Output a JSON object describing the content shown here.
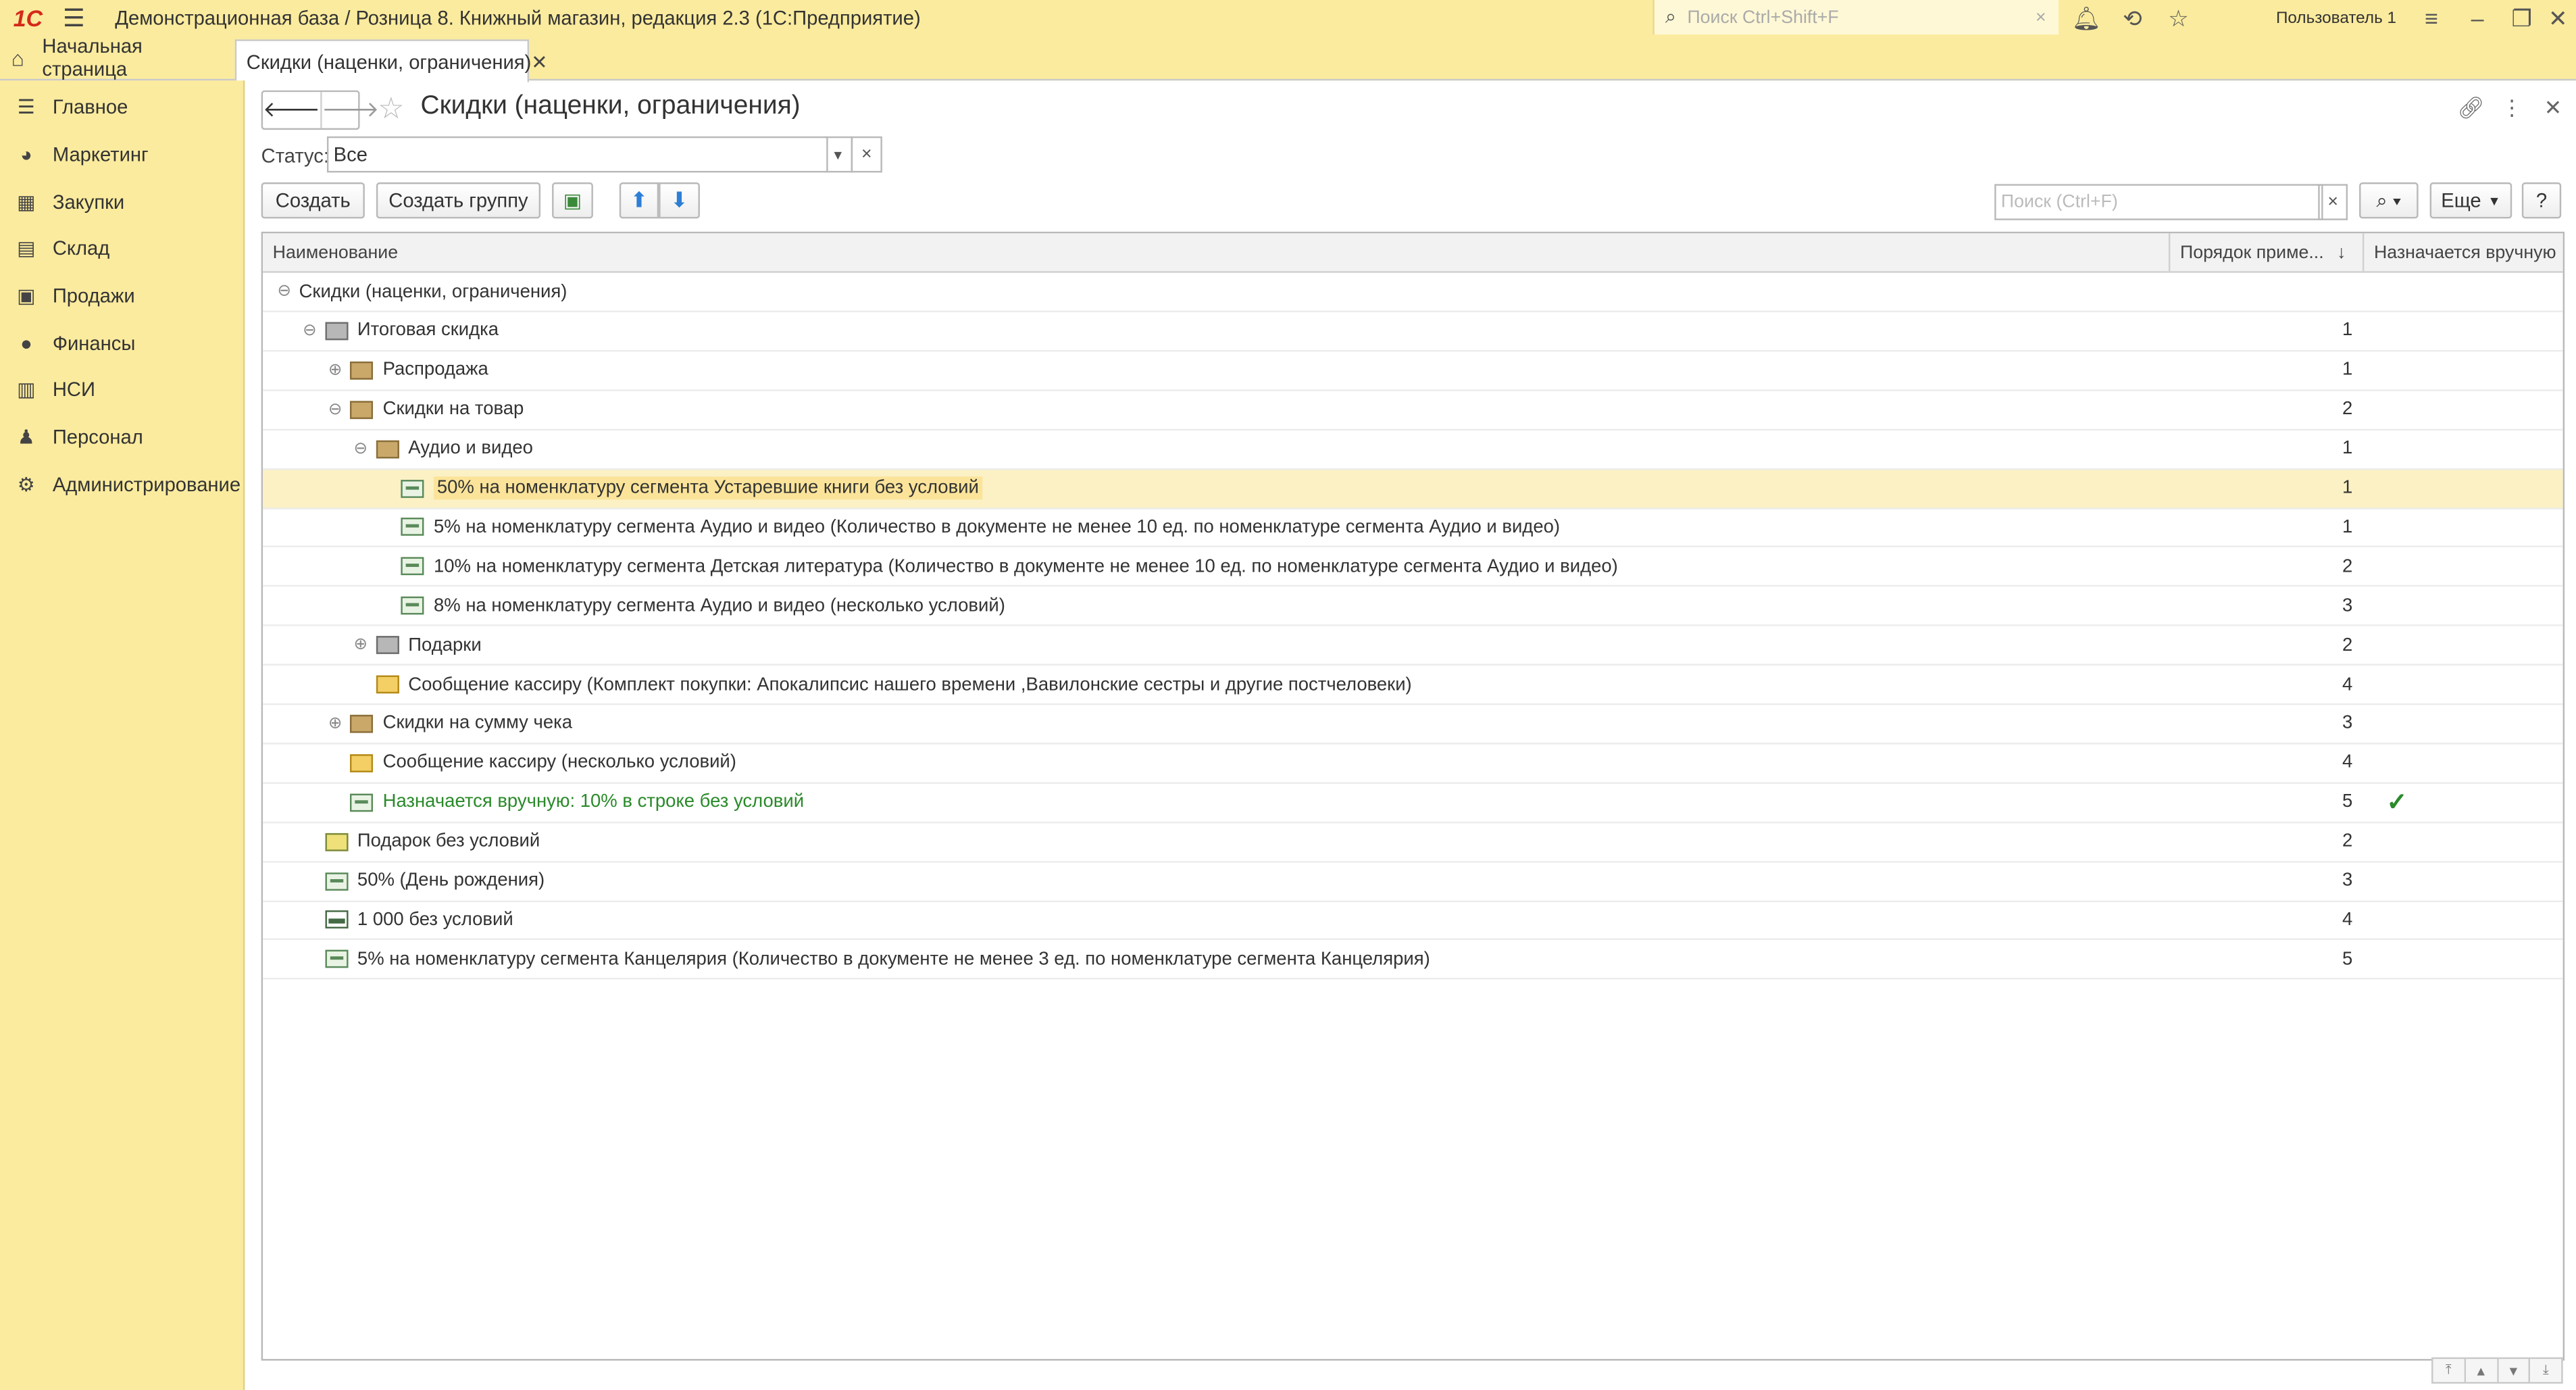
{
  "app": {
    "logo_text": "1С",
    "title": "Демонстрационная база / Розница 8. Книжный магазин, редакция 2.3  (1С:Предприятие)",
    "search_placeholder": "Поиск Ctrl+Shift+F",
    "user": "Пользователь 1"
  },
  "tabs": {
    "home_label": "Начальная страница",
    "active_label": "Скидки (наценки, ограничения)"
  },
  "sidebar": {
    "items": [
      {
        "label": "Главное",
        "icon": "menu-lines-icon"
      },
      {
        "label": "Маркетинг",
        "icon": "pie-chart-icon"
      },
      {
        "label": "Закупки",
        "icon": "grid-icon"
      },
      {
        "label": "Склад",
        "icon": "warehouse-icon"
      },
      {
        "label": "Продажи",
        "icon": "cart-icon"
      },
      {
        "label": "Финансы",
        "icon": "ruble-icon"
      },
      {
        "label": "НСИ",
        "icon": "book-icon"
      },
      {
        "label": "Персонал",
        "icon": "person-icon"
      },
      {
        "label": "Администрирование",
        "icon": "gear-icon"
      }
    ]
  },
  "form": {
    "title": "Скидки (наценки, ограничения)",
    "status_label": "Статус:",
    "status_value": "Все",
    "create_label": "Создать",
    "create_group_label": "Создать группу",
    "search_placeholder": "Поиск (Ctrl+F)",
    "more_label": "Еще",
    "help_label": "?"
  },
  "table": {
    "columns": [
      "Наименование",
      "Порядок приме...",
      "Назначается вручную"
    ],
    "rows": [
      {
        "level": 0,
        "toggle": "⊖",
        "icon": "none",
        "name": "Скидки (наценки, ограничения)",
        "order": ""
      },
      {
        "level": 1,
        "toggle": "⊖",
        "icon": "group",
        "name": "Итоговая скидка",
        "order": "1"
      },
      {
        "level": 2,
        "toggle": "⊕",
        "icon": "folder",
        "name": "Распродажа",
        "order": "1"
      },
      {
        "level": 2,
        "toggle": "⊖",
        "icon": "folder",
        "name": "Скидки на товар",
        "order": "2"
      },
      {
        "level": 3,
        "toggle": "⊖",
        "icon": "folder",
        "name": "Аудио и видео",
        "order": "1"
      },
      {
        "level": 4,
        "toggle": "",
        "icon": "item",
        "name": "50% на номенклатуру сегмента Устаревшие книги без условий",
        "order": "1",
        "selected": true
      },
      {
        "level": 4,
        "toggle": "",
        "icon": "item",
        "name": "5% на номенклатуру сегмента Аудио и видео (Количество в документе не менее 10 ед. по номенклатуре сегмента Аудио и видео)",
        "order": "1"
      },
      {
        "level": 4,
        "toggle": "",
        "icon": "item",
        "name": "10% на номенклатуру сегмента Детская литература (Количество в документе не менее 10 ед. по номенклатуре сегмента Аудио и видео)",
        "order": "2"
      },
      {
        "level": 4,
        "toggle": "",
        "icon": "item",
        "name": "8% на номенклатуру сегмента Аудио и видео (несколько условий)",
        "order": "3"
      },
      {
        "level": 3,
        "toggle": "⊕",
        "icon": "group",
        "name": "Подарки",
        "order": "2"
      },
      {
        "level": 3,
        "toggle": "",
        "icon": "msg",
        "name": "Сообщение кассиру (Комплект покупки: Апокалипсис нашего времени ,Вавилонские сестры и другие постчеловеки)",
        "order": "4"
      },
      {
        "level": 2,
        "toggle": "⊕",
        "icon": "folder",
        "name": "Скидки на сумму чека",
        "order": "3"
      },
      {
        "level": 2,
        "toggle": "",
        "icon": "msg",
        "name": "Сообщение кассиру (несколько условий)",
        "order": "4"
      },
      {
        "level": 2,
        "toggle": "",
        "icon": "item",
        "name": "Назначается вручную: 10% в строке без условий",
        "order": "5",
        "manual": true
      },
      {
        "level": 1,
        "toggle": "",
        "icon": "gift",
        "name": "Подарок без условий",
        "order": "2"
      },
      {
        "level": 1,
        "toggle": "",
        "icon": "item",
        "name": "50% (День рождения)",
        "order": "3"
      },
      {
        "level": 1,
        "toggle": "",
        "icon": "money",
        "name": "1 000 без условий",
        "order": "4"
      },
      {
        "level": 1,
        "toggle": "",
        "icon": "item",
        "name": "5% на номенклатуру сегмента Канцелярия (Количество в документе не менее 3 ед. по номенклатуре сегмента Канцелярия)",
        "order": "5"
      }
    ],
    "manual_mark": "✓"
  }
}
